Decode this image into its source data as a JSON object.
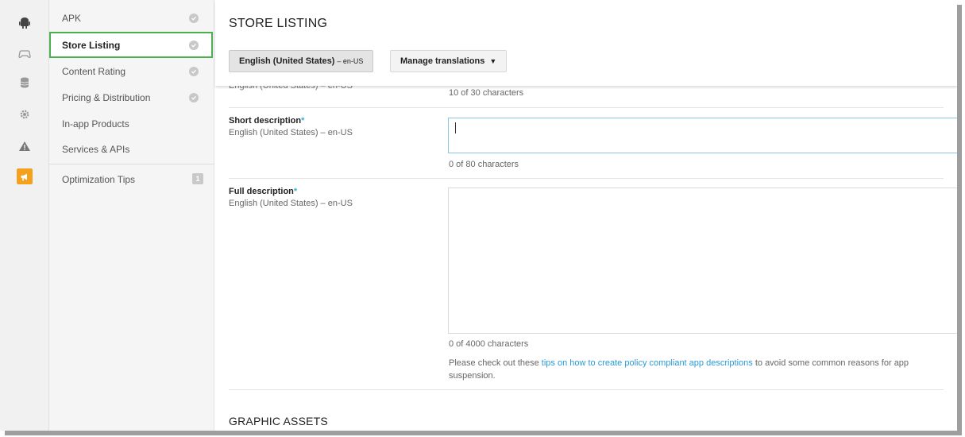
{
  "rail": {
    "icons": [
      "android-icon",
      "gamepad-icon",
      "database-icon",
      "gear-icon",
      "warning-icon",
      "megaphone-icon"
    ],
    "active_color": "#f4a21d"
  },
  "nav": {
    "items": [
      {
        "label": "APK",
        "status": "check"
      },
      {
        "label": "Store Listing",
        "status": "check",
        "selected": true
      },
      {
        "label": "Content Rating",
        "status": "check"
      },
      {
        "label": "Pricing & Distribution",
        "status": "check"
      },
      {
        "label": "In-app Products"
      },
      {
        "label": "Services & APIs"
      }
    ],
    "tips": {
      "label": "Optimization Tips",
      "count": "1"
    }
  },
  "header": {
    "title": "STORE LISTING",
    "language_button": {
      "label": "English (United States)",
      "code": "– en-US"
    },
    "manage_button": {
      "label": "Manage translations",
      "caret": "▼"
    }
  },
  "form": {
    "title_field": {
      "language": "English (United States) – en-US",
      "counter": "10 of 30 characters"
    },
    "short_description": {
      "label": "Short description",
      "required_mark": "*",
      "language": "English (United States) – en-US",
      "value": "",
      "counter": "0 of 80 characters"
    },
    "full_description": {
      "label": "Full description",
      "required_mark": "*",
      "language": "English (United States) – en-US",
      "value": "",
      "counter": "0 of 4000 characters"
    },
    "policy_note": {
      "prefix": "Please check out these ",
      "link": "tips on how to create policy compliant app descriptions",
      "suffix": " to avoid some common reasons for app suspension."
    }
  },
  "graphic_assets_title": "GRAPHIC ASSETS",
  "colors": {
    "selected_border": "#4caf50",
    "link": "#2a9bd6",
    "required": "#3db0c9",
    "focus_border": "#8cc4e8"
  }
}
